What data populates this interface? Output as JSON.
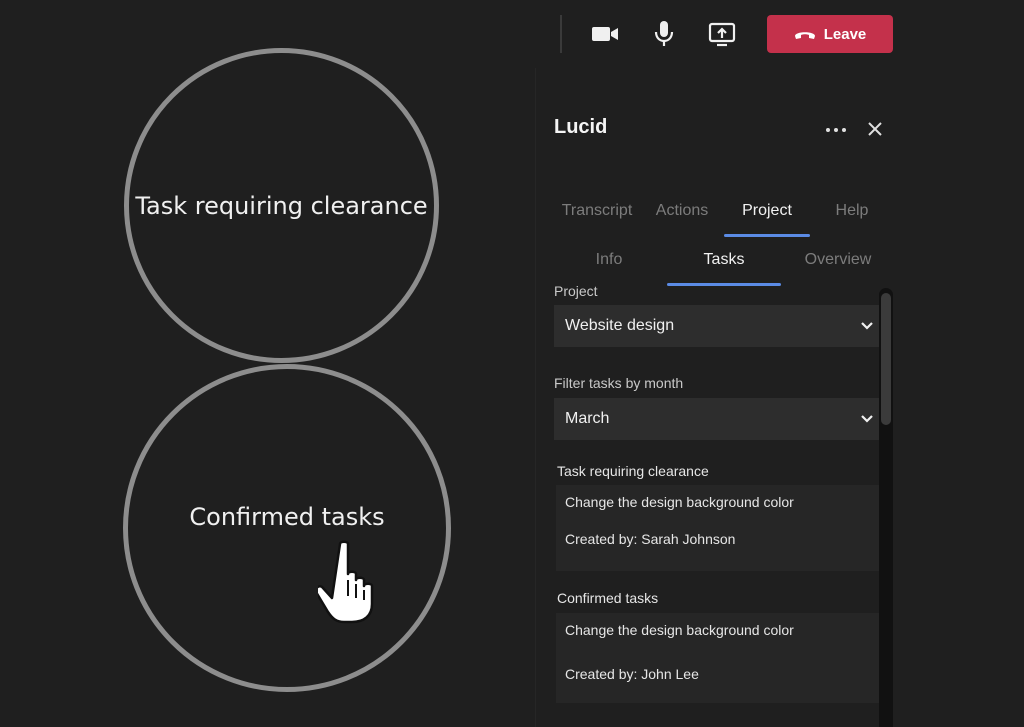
{
  "callouts": {
    "top_label": "Task requiring clearance",
    "bottom_label": "Confirmed tasks"
  },
  "toolbar": {
    "camera_icon": "video-camera-icon",
    "mic_icon": "microphone-icon",
    "share_icon": "share-screen-icon",
    "leave_label": "Leave",
    "leave_color": "#c4314b"
  },
  "panel": {
    "title": "Lucid",
    "tabs": [
      {
        "label": "Transcript",
        "active": false
      },
      {
        "label": "Actions",
        "active": false
      },
      {
        "label": "Project",
        "active": true
      },
      {
        "label": "Help",
        "active": false
      }
    ],
    "subtabs": [
      {
        "label": "Info",
        "active": false
      },
      {
        "label": "Tasks",
        "active": true
      },
      {
        "label": "Overview",
        "active": false
      }
    ],
    "accent_color": "#5b8be5",
    "project_label": "Project",
    "project_value": "Website design",
    "filter_label": "Filter tasks by month",
    "filter_value": "March",
    "pending_section": {
      "label": "Task requiring clearance",
      "task": "Change the design background color",
      "created_by": "Created by: Sarah Johnson"
    },
    "confirmed_section": {
      "label": "Confirmed tasks",
      "task": "Change the design background color",
      "created_by": "Created by: John Lee"
    }
  }
}
